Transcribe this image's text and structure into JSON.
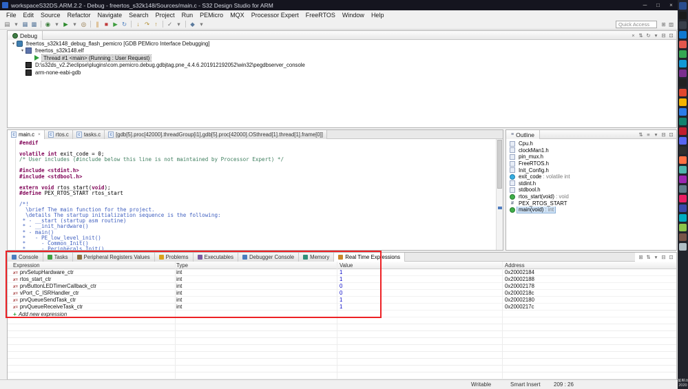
{
  "window": {
    "title": "workspaceS32DS.ARM.2.2 - Debug - freertos_s32k148/Sources/main.c - S32 Design Studio for ARM",
    "controls": [
      {
        "name": "minimize",
        "glyph": "─"
      },
      {
        "name": "maximize",
        "glyph": "□"
      },
      {
        "name": "close",
        "glyph": "×"
      }
    ]
  },
  "menubar": {
    "items": [
      "File",
      "Edit",
      "Source",
      "Refactor",
      "Navigate",
      "Search",
      "Project",
      "Run",
      "PEMicro",
      "MQX",
      "Processor Expert",
      "FreeRTOS",
      "Window",
      "Help"
    ]
  },
  "toolbar": {
    "quick_access_label": "Quick Access",
    "icons": [
      {
        "name": "new-wizard-icon",
        "glyph": "▤",
        "color": "#6e6e6e"
      },
      {
        "name": "dropdown-icon",
        "glyph": "▾",
        "color": "#777777"
      },
      {
        "name": "save-icon",
        "glyph": "▦",
        "color": "#5b7a9d"
      },
      {
        "name": "save-all-icon",
        "glyph": "▩",
        "color": "#5b7a9d"
      },
      {
        "sep": true
      },
      {
        "name": "debug-icon",
        "glyph": "◉",
        "color": "#3a7d3a"
      },
      {
        "name": "dropdown-icon",
        "glyph": "▾",
        "color": "#777777"
      },
      {
        "name": "run-icon",
        "glyph": "▶",
        "color": "#2e8b2e"
      },
      {
        "name": "dropdown-icon",
        "glyph": "▾",
        "color": "#777777"
      },
      {
        "name": "profile-icon",
        "glyph": "◎",
        "color": "#8a6d3b"
      },
      {
        "sep": true
      },
      {
        "name": "suspend-icon",
        "glyph": "∥",
        "color": "#c9872a"
      },
      {
        "name": "terminate-icon",
        "glyph": "■",
        "color": "#c03a3a"
      },
      {
        "name": "resume-icon",
        "glyph": "▶",
        "color": "#3f9e3f"
      },
      {
        "name": "restart-icon",
        "glyph": "↻",
        "color": "#4a7dbf"
      },
      {
        "sep": true
      },
      {
        "name": "step-into-icon",
        "glyph": "↓",
        "color": "#b08a2a"
      },
      {
        "name": "step-over-icon",
        "glyph": "↷",
        "color": "#b08a2a"
      },
      {
        "name": "step-return-icon",
        "glyph": "↑",
        "color": "#b08a2a"
      },
      {
        "sep": true
      },
      {
        "name": "mark-occurrences-icon",
        "glyph": "✓",
        "color": "#6e6e6e"
      },
      {
        "name": "dropdown-icon",
        "glyph": "▾",
        "color": "#777777"
      },
      {
        "sep": true
      },
      {
        "name": "external-tools-icon",
        "glyph": "◆",
        "color": "#5b7a9d"
      },
      {
        "name": "dropdown-icon",
        "glyph": "▾",
        "color": "#777777"
      }
    ],
    "right_icons": [
      {
        "name": "perspective-debug-icon",
        "glyph": "⊞"
      },
      {
        "name": "perspective-cpp-icon",
        "glyph": "▨"
      }
    ]
  },
  "debug_panel": {
    "tab": "Debug",
    "header_icons": [
      {
        "name": "remove-terminated-icon",
        "glyph": "×"
      },
      {
        "name": "collapse-all-icon",
        "glyph": "⇅"
      },
      {
        "name": "restart-icon",
        "glyph": "↻"
      },
      {
        "name": "view-menu-icon",
        "glyph": "▾"
      },
      {
        "name": "minimize-icon",
        "glyph": "⊟"
      },
      {
        "name": "maximize-icon",
        "glyph": "⊡"
      }
    ],
    "tree": [
      {
        "label": "freertos_s32k148_debug_flash_pemicro [GDB PEMicro Interface Debugging]",
        "level": 0,
        "icon": "launch",
        "expanded": true
      },
      {
        "label": "freertos_s32k148.elf",
        "level": 1,
        "icon": "elf",
        "expanded": true
      },
      {
        "label": "Thread #1 <main> (Running : User Request)",
        "level": 2,
        "icon": "thread",
        "selected": true
      },
      {
        "label": "D:\\s32ds_v2.2\\eclipse\\plugins\\com.pemicro.debug.gdbjtag.pne_4.4.6.201912192052\\win32\\pegdbserver_console",
        "level": 1,
        "icon": "process"
      },
      {
        "label": "arm-none-eabi-gdb",
        "level": 1,
        "icon": "process"
      }
    ]
  },
  "editor": {
    "tabs": [
      {
        "label": "main.c",
        "active": true
      },
      {
        "label": "rtos.c"
      },
      {
        "label": "tasks.c"
      },
      {
        "label": "[gdb[5].proc[42000].threadGroup[i1],gdb[5].proc[42000].OSthread[1].thread[1].frame[0]]"
      }
    ],
    "lines": [
      [
        [
          "#endif",
          "dir"
        ]
      ],
      [],
      [
        [
          "volatile",
          "kw"
        ],
        [
          " ",
          "pl"
        ],
        [
          "int",
          "kw"
        ],
        [
          " exit_code = 0;",
          "pl"
        ]
      ],
      [
        [
          "/* User includes (#include below this line is not maintained by Processor Expert) */",
          "cm"
        ]
      ],
      [],
      [
        [
          "#include",
          "dir"
        ],
        [
          " ",
          "pl"
        ],
        [
          "<stdint.h>",
          "dir"
        ]
      ],
      [
        [
          "#include",
          "dir"
        ],
        [
          " ",
          "pl"
        ],
        [
          "<stdbool.h>",
          "dir"
        ]
      ],
      [],
      [
        [
          "extern",
          "kw"
        ],
        [
          " ",
          "pl"
        ],
        [
          "void",
          "kw"
        ],
        [
          " rtos_start(",
          "pl"
        ],
        [
          "void",
          "kw"
        ],
        [
          ");",
          "pl"
        ]
      ],
      [
        [
          "#define",
          "dir"
        ],
        [
          " PEX_RTOS_START rtos_start",
          "pl"
        ]
      ],
      [],
      [
        [
          "/*!",
          "doc"
        ]
      ],
      [
        [
          "  \\brief The main function for the project.",
          "doc"
        ]
      ],
      [
        [
          "  \\details The startup initialization sequence is the following:",
          "doc"
        ]
      ],
      [
        [
          " * - __start (startup asm routine)",
          "doc"
        ]
      ],
      [
        [
          " * - __init_hardware()",
          "doc"
        ]
      ],
      [
        [
          " * - main()",
          "doc"
        ]
      ],
      [
        [
          " *   - PE_low_level_init()",
          "doc"
        ]
      ],
      [
        [
          " *     - Common_Init()",
          "doc"
        ]
      ],
      [
        [
          " *     - Peripherals_Init()",
          "doc"
        ]
      ]
    ]
  },
  "outline": {
    "tab": "Outline",
    "header_icons": [
      {
        "name": "sort-icon",
        "glyph": "⇅"
      },
      {
        "name": "hide-fields-icon",
        "glyph": "≡"
      },
      {
        "name": "view-menu-icon",
        "glyph": "▾"
      },
      {
        "name": "minimize-icon",
        "glyph": "⊟"
      },
      {
        "name": "maximize-icon",
        "glyph": "⊡"
      }
    ],
    "items": [
      {
        "name": "Cpu.h",
        "icon": "include"
      },
      {
        "name": "clockMan1.h",
        "icon": "include"
      },
      {
        "name": "pin_mux.h",
        "icon": "include"
      },
      {
        "name": "FreeRTOS.h",
        "icon": "include"
      },
      {
        "name": "Init_Config.h",
        "icon": "include"
      },
      {
        "name": "exit_code",
        "suffix": " : volatile int",
        "icon": "variable"
      },
      {
        "name": "stdint.h",
        "icon": "include"
      },
      {
        "name": "stdbool.h",
        "icon": "include"
      },
      {
        "name": "rtos_start(void)",
        "suffix": " : void",
        "icon": "function"
      },
      {
        "name": "PEX_RTOS_START",
        "icon": "define"
      },
      {
        "name": "main(void)",
        "suffix": " : int",
        "icon": "function",
        "selected": true
      }
    ]
  },
  "bottom_panel": {
    "tabs": [
      {
        "label": "Console",
        "icon": "console",
        "icon_color": "#4a7dbf"
      },
      {
        "label": "Tasks",
        "icon": "tasks",
        "icon_color": "#3f9e3f"
      },
      {
        "label": "Peripheral Registers Values",
        "icon": "registers",
        "icon_color": "#8a6d3b"
      },
      {
        "label": "Problems",
        "icon": "problems",
        "icon_color": "#d9a21b"
      },
      {
        "label": "Executables",
        "icon": "executables",
        "icon_color": "#7a5aa0"
      },
      {
        "label": "Debugger Console",
        "icon": "debugger-console",
        "icon_color": "#4a7dbf"
      },
      {
        "label": "Memory",
        "icon": "memory",
        "icon_color": "#2f8f7a"
      },
      {
        "label": "Real Time Expressions",
        "icon": "expressions",
        "icon_color": "#c9872a",
        "active": true
      }
    ],
    "header_icons": [
      {
        "name": "add-icon",
        "glyph": "⊞"
      },
      {
        "name": "collapse-all-icon",
        "glyph": "⇅"
      },
      {
        "name": "view-menu-icon",
        "glyph": "▾"
      },
      {
        "name": "minimize-icon",
        "glyph": "⊟"
      },
      {
        "name": "maximize-icon",
        "glyph": "⊡"
      }
    ],
    "table": {
      "columns": [
        "Expression",
        "Type",
        "Value",
        "Address"
      ],
      "rows": [
        {
          "expression": "prvSetupHardware_ctr",
          "type": "int",
          "value": "1",
          "address": "0x20002184"
        },
        {
          "expression": "rtos_start_ctr",
          "type": "int",
          "value": "1",
          "address": "0x20002188"
        },
        {
          "expression": "prvButtonLEDTimerCallback_ctr",
          "type": "int",
          "value": "0",
          "address": "0x20002178"
        },
        {
          "expression": "vPort_C_ISRHandler_ctr",
          "type": "int",
          "value": "0",
          "address": "0x2000218c"
        },
        {
          "expression": "prvQueueSendTask_ctr",
          "type": "int",
          "value": "1",
          "address": "0x20002180"
        },
        {
          "expression": "prvQueueReceiveTask_ctr",
          "type": "int",
          "value": "1",
          "address": "0x2000217c"
        }
      ],
      "add_row_label": "Add new expression",
      "value_color": "#0000c4"
    }
  },
  "status_bar": {
    "items": [
      "Writable",
      "Smart Insert",
      "209 : 26"
    ]
  },
  "taskbar": {
    "clock": {
      "line1": "星期五",
      "line2": "2020"
    },
    "icons": [
      {
        "name": "taskbar-app-icon",
        "color": "#2a4d8f"
      },
      {
        "name": "taskbar-app-icon",
        "color": "#1b1b1b"
      },
      {
        "name": "taskbar-app-icon",
        "color": "#3a3f4a"
      },
      {
        "name": "taskbar-app-icon",
        "color": "#0e78d1"
      },
      {
        "name": "taskbar-app-icon",
        "color": "#e2574c"
      },
      {
        "name": "taskbar-app-icon",
        "color": "#34a853"
      },
      {
        "name": "taskbar-app-icon",
        "color": "#1099d6"
      },
      {
        "name": "taskbar-app-icon",
        "color": "#7a2f8f"
      },
      {
        "name": "taskbar-app-icon",
        "color": "#202020"
      },
      {
        "name": "taskbar-app-icon",
        "color": "#e0482e"
      },
      {
        "name": "taskbar-app-icon",
        "color": "#f4b400"
      },
      {
        "name": "taskbar-app-icon",
        "color": "#2b7de9"
      },
      {
        "name": "taskbar-app-icon",
        "color": "#12826e"
      },
      {
        "name": "taskbar-app-icon",
        "color": "#c01e2e"
      },
      {
        "name": "taskbar-app-icon",
        "color": "#5865f2"
      },
      {
        "name": "taskbar-app-icon",
        "color": "#2e2e2e"
      },
      {
        "name": "taskbar-app-icon",
        "color": "#ff7043"
      },
      {
        "name": "taskbar-app-icon",
        "color": "#4db6ac"
      },
      {
        "name": "taskbar-app-icon",
        "color": "#9c27b0"
      },
      {
        "name": "taskbar-app-icon",
        "color": "#607d8b"
      },
      {
        "name": "taskbar-app-icon",
        "color": "#e91e63"
      },
      {
        "name": "taskbar-app-icon",
        "color": "#3949ab"
      },
      {
        "name": "taskbar-app-icon",
        "color": "#00acc1"
      },
      {
        "name": "taskbar-app-icon",
        "color": "#8bc34a"
      },
      {
        "name": "taskbar-app-icon",
        "color": "#795548"
      },
      {
        "name": "taskbar-app-icon",
        "color": "#b0bec5"
      }
    ]
  }
}
